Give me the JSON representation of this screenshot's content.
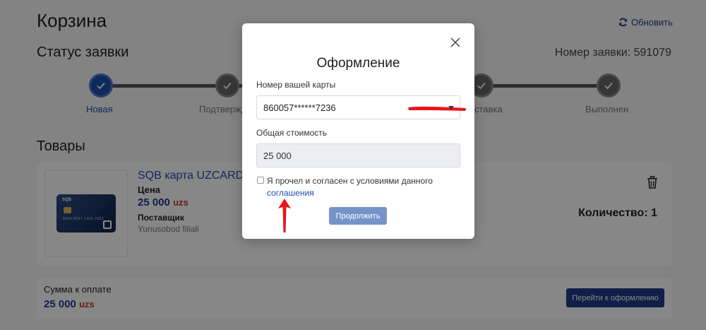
{
  "page": {
    "title": "Корзина",
    "refresh_label": "Обновить",
    "status_title": "Статус заявки",
    "order_number": "Номер заявки: 591079"
  },
  "stepper": {
    "steps": [
      {
        "label": "Новая",
        "active": true
      },
      {
        "label": "Подтвержд",
        "active": false
      },
      {
        "label": "",
        "active": false
      },
      {
        "label": "ставка",
        "active": false
      },
      {
        "label": "Выполнен",
        "active": false
      }
    ]
  },
  "goods": {
    "title": "Товары",
    "product": {
      "name": "SQB карта UZCARD",
      "price_label": "Цена",
      "price_value": "25 000",
      "currency": "uzs",
      "supplier_label": "Поставщик",
      "supplier_name": "Yunusobod filiali",
      "quantity": "Количество: 1",
      "card_brand": "SQB",
      "card_number": "8600 0057 1402 2022"
    }
  },
  "summary": {
    "label": "Сумма к оплате",
    "amount": "25 000",
    "currency": "uzs",
    "checkout_label": "Перейти к оформлению"
  },
  "modal": {
    "title": "Оформление",
    "card_label": "Номер вашей карты",
    "card_value": "860057******7236",
    "total_label": "Общая стоимость",
    "total_value": "25 000",
    "agree_text": "Я прочел и согласен с условиями данного",
    "agree_link": "соглашения",
    "agree_checked": false,
    "continue_label": "Продолжить"
  },
  "colors": {
    "primary": "#1f3c88",
    "accent_blue": "#1f4fb0",
    "currency_red": "#c0392b",
    "button_disabled": "#7693c9",
    "annotation_red": "#e8141c"
  },
  "icons": {
    "refresh": "refresh-icon",
    "step": "check-icon",
    "delete": "trash-icon",
    "close": "close-icon",
    "dropdown": "chevron-down-icon",
    "annotation": "arrow-up-icon"
  }
}
